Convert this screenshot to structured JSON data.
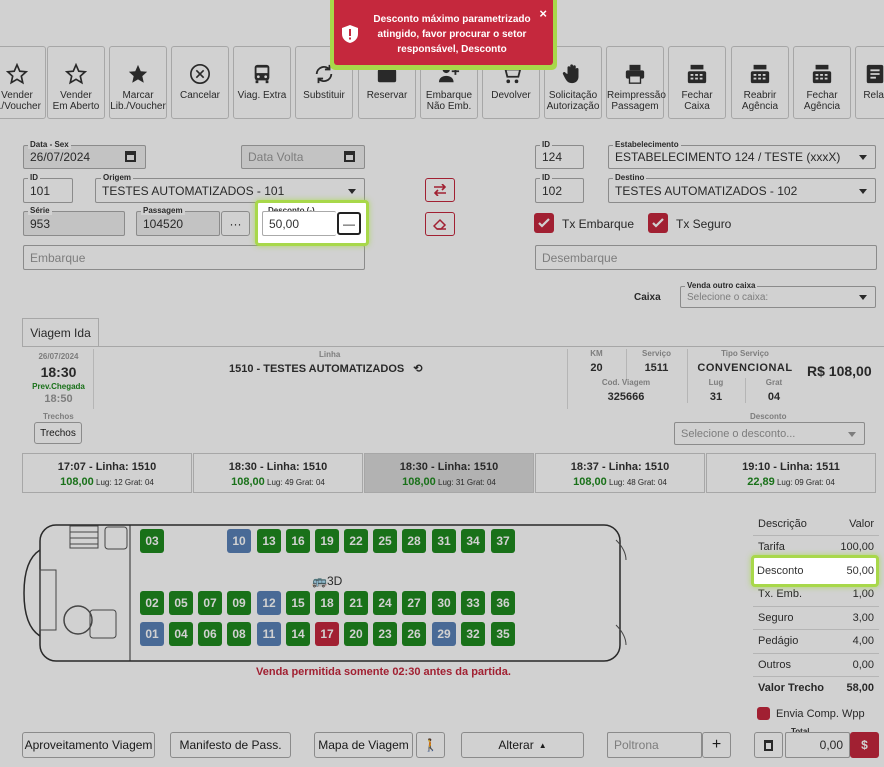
{
  "toolbar": [
    {
      "label": "Vender\nL./Voucher",
      "icon": "star-outline-icon"
    },
    {
      "label": "Vender\nEm Aberto",
      "icon": "star-outline-icon"
    },
    {
      "label": "Marcar\nLib./Voucher",
      "icon": "star-filled-icon"
    },
    {
      "label": "Cancelar",
      "icon": "cancel-circle-icon"
    },
    {
      "label": "Viag. Extra",
      "icon": "bus-icon"
    },
    {
      "label": "Substituir",
      "icon": "refresh-icon"
    },
    {
      "label": "Reservar",
      "icon": "briefcase-icon"
    },
    {
      "label": "Embarque\nNão Emb.",
      "icon": "user-add-icon"
    },
    {
      "label": "Devolver",
      "icon": "cart-icon"
    },
    {
      "label": "Solicitação\nAutorização",
      "icon": "hand-icon"
    },
    {
      "label": "Reimpressão\nPassagem",
      "icon": "printer-icon"
    },
    {
      "label": "Fechar\nCaixa",
      "icon": "cash-register-icon"
    },
    {
      "label": "Reabrir\nAgência",
      "icon": "cash-register-icon"
    },
    {
      "label": "Fechar\nAgência",
      "icon": "cash-register-icon"
    },
    {
      "label": "Relat",
      "icon": "report-icon"
    }
  ],
  "alert": {
    "message": "Desconto máximo parametrizado atingido, favor procurar o setor responsável, Desconto",
    "close": "×"
  },
  "form": {
    "date_label": "Data - Sex",
    "date_value": "26/07/2024",
    "return_placeholder": "Data Volta",
    "origin_id_label": "ID",
    "origin_id": "101",
    "origin_label": "Origem",
    "origin_value": "TESTES AUTOMATIZADOS - 101",
    "serie_label": "Série",
    "serie_value": "953",
    "passagem_label": "Passagem",
    "passagem_value": "104520",
    "passagem_btn": "···",
    "desconto_label": "Desconto (-)",
    "desconto_value": "50,00",
    "desconto_btn": "—",
    "embarque_placeholder": "Embarque",
    "estab_id_label": "ID",
    "estab_id": "124",
    "estab_label": "Estabelecimento",
    "estab_value": "ESTABELECIMENTO 124 / TESTE (xxxX)",
    "dest_id_label": "ID",
    "dest_id": "102",
    "dest_label": "Destino",
    "dest_value": "TESTES AUTOMATIZADOS - 102",
    "tx_embarque": "Tx Embarque",
    "tx_seguro": "Tx Seguro",
    "desembarque_placeholder": "Desembarque",
    "caixa_label": "Caixa",
    "venda_outro_caixa_label": "Venda outro caixa",
    "caixa_placeholder": "Selecione o caixa:"
  },
  "tab": "Viagem Ida",
  "trip_info": {
    "date": "26/07/2024",
    "time": "18:30",
    "prev_chegada_label": "Prev.Chegada",
    "arrival": "18:50",
    "trechos_label": "Trechos",
    "trechos_btn": "Trechos",
    "linha_label": "Linha",
    "linha_value": "1510 - TESTES AUTOMATIZADOS",
    "km_label": "KM",
    "km_value": "20",
    "servico_label": "Serviço",
    "servico_value": "1511",
    "tipo_label": "Tipo Serviço",
    "tipo_value": "CONVENCIONAL",
    "price": "R$ 108,00",
    "cod_label": "Cod. Viagem",
    "cod_value": "325666",
    "lug_label": "Lug",
    "lug_value": "31",
    "grat_label": "Grat",
    "grat_value": "04",
    "desconto_label": "Desconto",
    "desconto_placeholder": "Selecione o desconto..."
  },
  "trips": [
    {
      "title": "17:07 - Linha: 1510",
      "price": "108,00",
      "lug": "Lug: 12",
      "grat": "Grat: 04"
    },
    {
      "title": "18:30 - Linha: 1510",
      "price": "108,00",
      "lug": "Lug: 49",
      "grat": "Grat: 04"
    },
    {
      "title": "18:30 - Linha: 1510",
      "price": "108,00",
      "lug": "Lug: 31",
      "grat": "Grat: 04"
    },
    {
      "title": "18:37 - Linha: 1510",
      "price": "108,00",
      "lug": "Lug: 48",
      "grat": "Grat: 04"
    },
    {
      "title": "19:10 - Linha: 1511",
      "price": "22,89",
      "lug": "Lug: 09",
      "grat": "Grat: 04"
    }
  ],
  "bus": {
    "label_3d": "3D",
    "warning": "Venda permitida somente 02:30 antes da partida.",
    "row1": [
      {
        "n": "03",
        "s": "free"
      },
      {
        "n": "10",
        "s": "occ"
      },
      {
        "n": "13",
        "s": "free"
      },
      {
        "n": "16",
        "s": "free"
      },
      {
        "n": "19",
        "s": "free"
      },
      {
        "n": "22",
        "s": "free"
      },
      {
        "n": "25",
        "s": "free"
      },
      {
        "n": "28",
        "s": "free"
      },
      {
        "n": "31",
        "s": "free"
      },
      {
        "n": "34",
        "s": "free"
      },
      {
        "n": "37",
        "s": "free"
      }
    ],
    "row2": [
      {
        "n": "02",
        "s": "free"
      },
      {
        "n": "05",
        "s": "free"
      },
      {
        "n": "07",
        "s": "free"
      },
      {
        "n": "09",
        "s": "free"
      },
      {
        "n": "12",
        "s": "occ"
      },
      {
        "n": "15",
        "s": "free"
      },
      {
        "n": "18",
        "s": "free"
      },
      {
        "n": "21",
        "s": "free"
      },
      {
        "n": "24",
        "s": "free"
      },
      {
        "n": "27",
        "s": "free"
      },
      {
        "n": "30",
        "s": "free"
      },
      {
        "n": "33",
        "s": "free"
      },
      {
        "n": "36",
        "s": "free"
      }
    ],
    "row3": [
      {
        "n": "01",
        "s": "occ"
      },
      {
        "n": "04",
        "s": "free"
      },
      {
        "n": "06",
        "s": "free"
      },
      {
        "n": "08",
        "s": "free"
      },
      {
        "n": "11",
        "s": "occ"
      },
      {
        "n": "14",
        "s": "free"
      },
      {
        "n": "17",
        "s": "sel"
      },
      {
        "n": "20",
        "s": "free"
      },
      {
        "n": "23",
        "s": "free"
      },
      {
        "n": "26",
        "s": "free"
      },
      {
        "n": "29",
        "s": "occ"
      },
      {
        "n": "32",
        "s": "free"
      },
      {
        "n": "35",
        "s": "free"
      }
    ]
  },
  "summary": {
    "h_desc": "Descrição",
    "h_valor": "Valor",
    "rows": [
      {
        "label": "Tarifa",
        "value": "100,00"
      },
      {
        "label": "Desconto",
        "value": "50,00"
      },
      {
        "label": "Tx. Emb.",
        "value": "1,00"
      },
      {
        "label": "Seguro",
        "value": "3,00"
      },
      {
        "label": "Pedágio",
        "value": "4,00"
      },
      {
        "label": "Outros",
        "value": "0,00"
      }
    ],
    "valor_trecho_label": "Valor Trecho",
    "valor_trecho": "58,00",
    "envia_comp": "Envia Comp. Wpp",
    "total_label": "Total",
    "total_value": "0,00",
    "pay_icon": "$"
  },
  "bottom": {
    "aproveitamento": "Aproveitamento Viagem",
    "manifesto": "Manifesto de Pass.",
    "mapa": "Mapa de Viagem",
    "alterar": "Alterar",
    "poltrona_placeholder": "Poltrona",
    "plus": "+"
  }
}
